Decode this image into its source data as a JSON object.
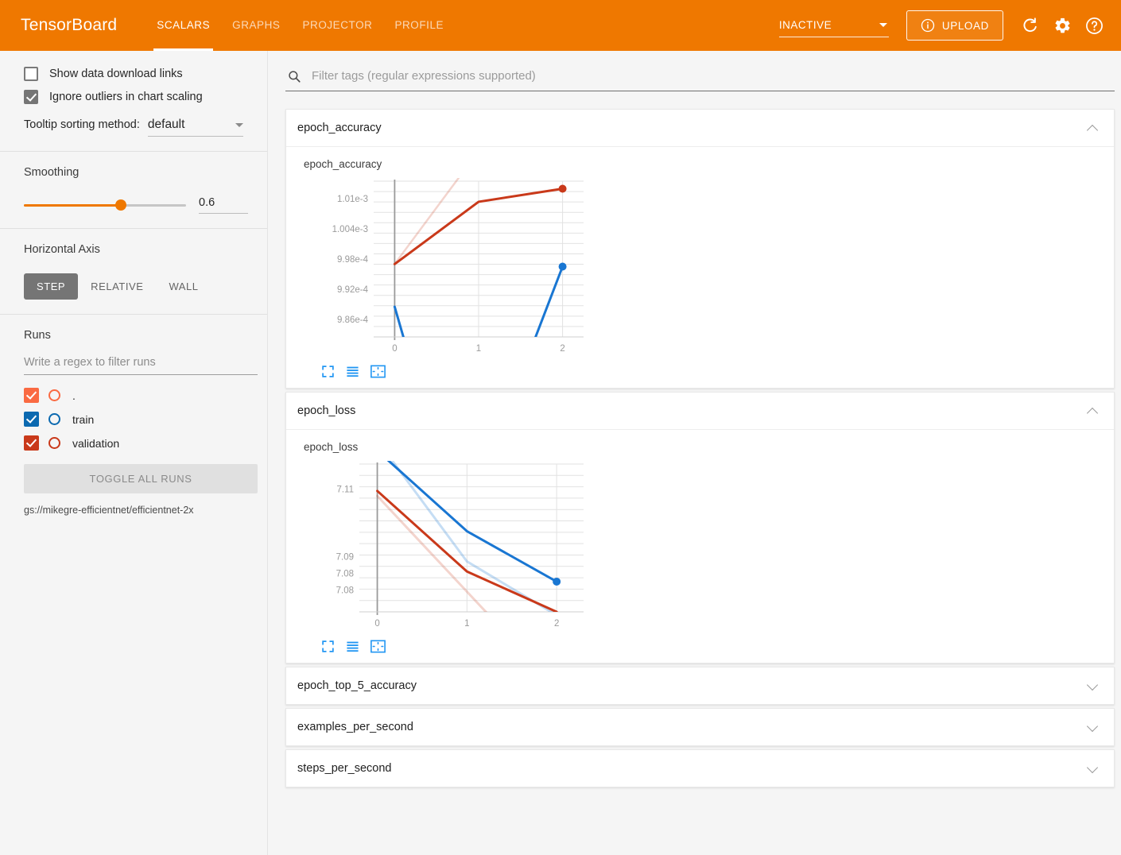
{
  "header": {
    "brand": "TensorBoard",
    "tabs": [
      {
        "label": "SCALARS",
        "active": true
      },
      {
        "label": "GRAPHS",
        "active": false
      },
      {
        "label": "PROJECTOR",
        "active": false
      },
      {
        "label": "PROFILE",
        "active": false
      }
    ],
    "status_select": "INACTIVE",
    "upload_label": "UPLOAD",
    "icons": [
      "info-icon",
      "refresh-icon",
      "gear-icon",
      "help-icon"
    ],
    "accent_color": "#ef7800"
  },
  "sidebar": {
    "show_download_links": {
      "label": "Show data download links",
      "checked": false
    },
    "ignore_outliers": {
      "label": "Ignore outliers in chart scaling",
      "checked": true
    },
    "tooltip_sorting": {
      "label": "Tooltip sorting method:",
      "value": "default"
    },
    "smoothing": {
      "title": "Smoothing",
      "value": "0.6",
      "percent": 60
    },
    "horizontal_axis": {
      "title": "Horizontal Axis",
      "options": [
        {
          "label": "STEP",
          "active": true
        },
        {
          "label": "RELATIVE",
          "active": false
        },
        {
          "label": "WALL",
          "active": false
        }
      ]
    },
    "runs": {
      "title": "Runs",
      "filter_placeholder": "Write a regex to filter runs",
      "filter_value": "",
      "items": [
        {
          "name": ".",
          "checked": true,
          "color": "#fa6a42"
        },
        {
          "name": "train",
          "checked": true,
          "color": "#0b69b0"
        },
        {
          "name": "validation",
          "checked": true,
          "color": "#c9391a"
        }
      ],
      "toggle_all_label": "TOGGLE ALL RUNS",
      "logdir": "gs://mikegre-efficientnet/efficientnet-2x"
    }
  },
  "main": {
    "filter_placeholder": "Filter tags (regular expressions supported)",
    "filter_value": "",
    "cards": [
      {
        "title": "epoch_accuracy",
        "expanded": true
      },
      {
        "title": "epoch_loss",
        "expanded": true
      },
      {
        "title": "epoch_top_5_accuracy",
        "expanded": false
      },
      {
        "title": "examples_per_second",
        "expanded": false
      },
      {
        "title": "steps_per_second",
        "expanded": false
      }
    ],
    "chart_toolbar_icons": [
      "expand-icon",
      "stack-lines-icon",
      "fit-domain-icon"
    ]
  },
  "chart_data": [
    {
      "type": "line",
      "title": "epoch_accuracy",
      "xlabel": "",
      "ylabel": "",
      "x": [
        0,
        1,
        2
      ],
      "xticks": [
        "0",
        "1",
        "2"
      ],
      "xlim": [
        -0.25,
        2.25
      ],
      "yticks": [
        "1.01e-3",
        "1.004e-3",
        "9.98e-4",
        "9.92e-4",
        "9.86e-4"
      ],
      "ytick_values": [
        0.00101,
        0.001004,
        0.000998,
        0.000992,
        0.000986
      ],
      "ylim": [
        0.0009825,
        0.0010135
      ],
      "grid": true,
      "legend": "none",
      "series": [
        {
          "name": "validation",
          "color": "#c9391a",
          "smoothed": true,
          "width": 3,
          "values": [
            0.000997,
            0.0010094,
            0.001012
          ],
          "marker_last": true
        },
        {
          "name": "validation-raw",
          "color": "#c9391a",
          "opacity": 0.22,
          "width": 2.5,
          "values": [
            0.000997,
            0.0010195,
            null
          ]
        },
        {
          "name": "train",
          "color": "#1976d2",
          "smoothed": true,
          "width": 3,
          "values": [
            0.0009885,
            null,
            0.0009965
          ],
          "marker_last": true
        },
        {
          "name": "train-raw",
          "color": "#1976d2",
          "opacity": 0.22,
          "width": 2.5,
          "values": [
            0.0009883,
            null,
            null
          ]
        }
      ]
    },
    {
      "type": "line",
      "title": "epoch_loss",
      "xlabel": "",
      "ylabel": "",
      "x": [
        0,
        1,
        2
      ],
      "xticks": [
        "0",
        "1",
        "2"
      ],
      "xlim": [
        -0.2,
        2.3
      ],
      "yticks": [
        "7.11",
        "7.09",
        "7.08",
        "7.08"
      ],
      "ytick_values": [
        7.11,
        7.09,
        7.085,
        7.08
      ],
      "ylim": [
        7.0735,
        7.1175
      ],
      "grid": true,
      "legend": "none",
      "series": [
        {
          "name": "train",
          "color": "#1976d2",
          "smoothed": true,
          "width": 3,
          "values": [
            7.1215,
            7.0975,
            7.0825
          ],
          "marker_last": true
        },
        {
          "name": "train-raw",
          "color": "#1976d2",
          "opacity": 0.25,
          "width": 3,
          "values": [
            7.1245,
            7.0885,
            7.0725
          ]
        },
        {
          "name": "validation",
          "color": "#c9391a",
          "smoothed": true,
          "width": 3,
          "values": [
            7.1095,
            7.0855,
            7.0735
          ],
          "marker_last": false
        },
        {
          "name": "validation-raw",
          "color": "#c9391a",
          "opacity": 0.22,
          "width": 3,
          "values": [
            7.108,
            7.0795,
            null
          ]
        }
      ]
    }
  ]
}
